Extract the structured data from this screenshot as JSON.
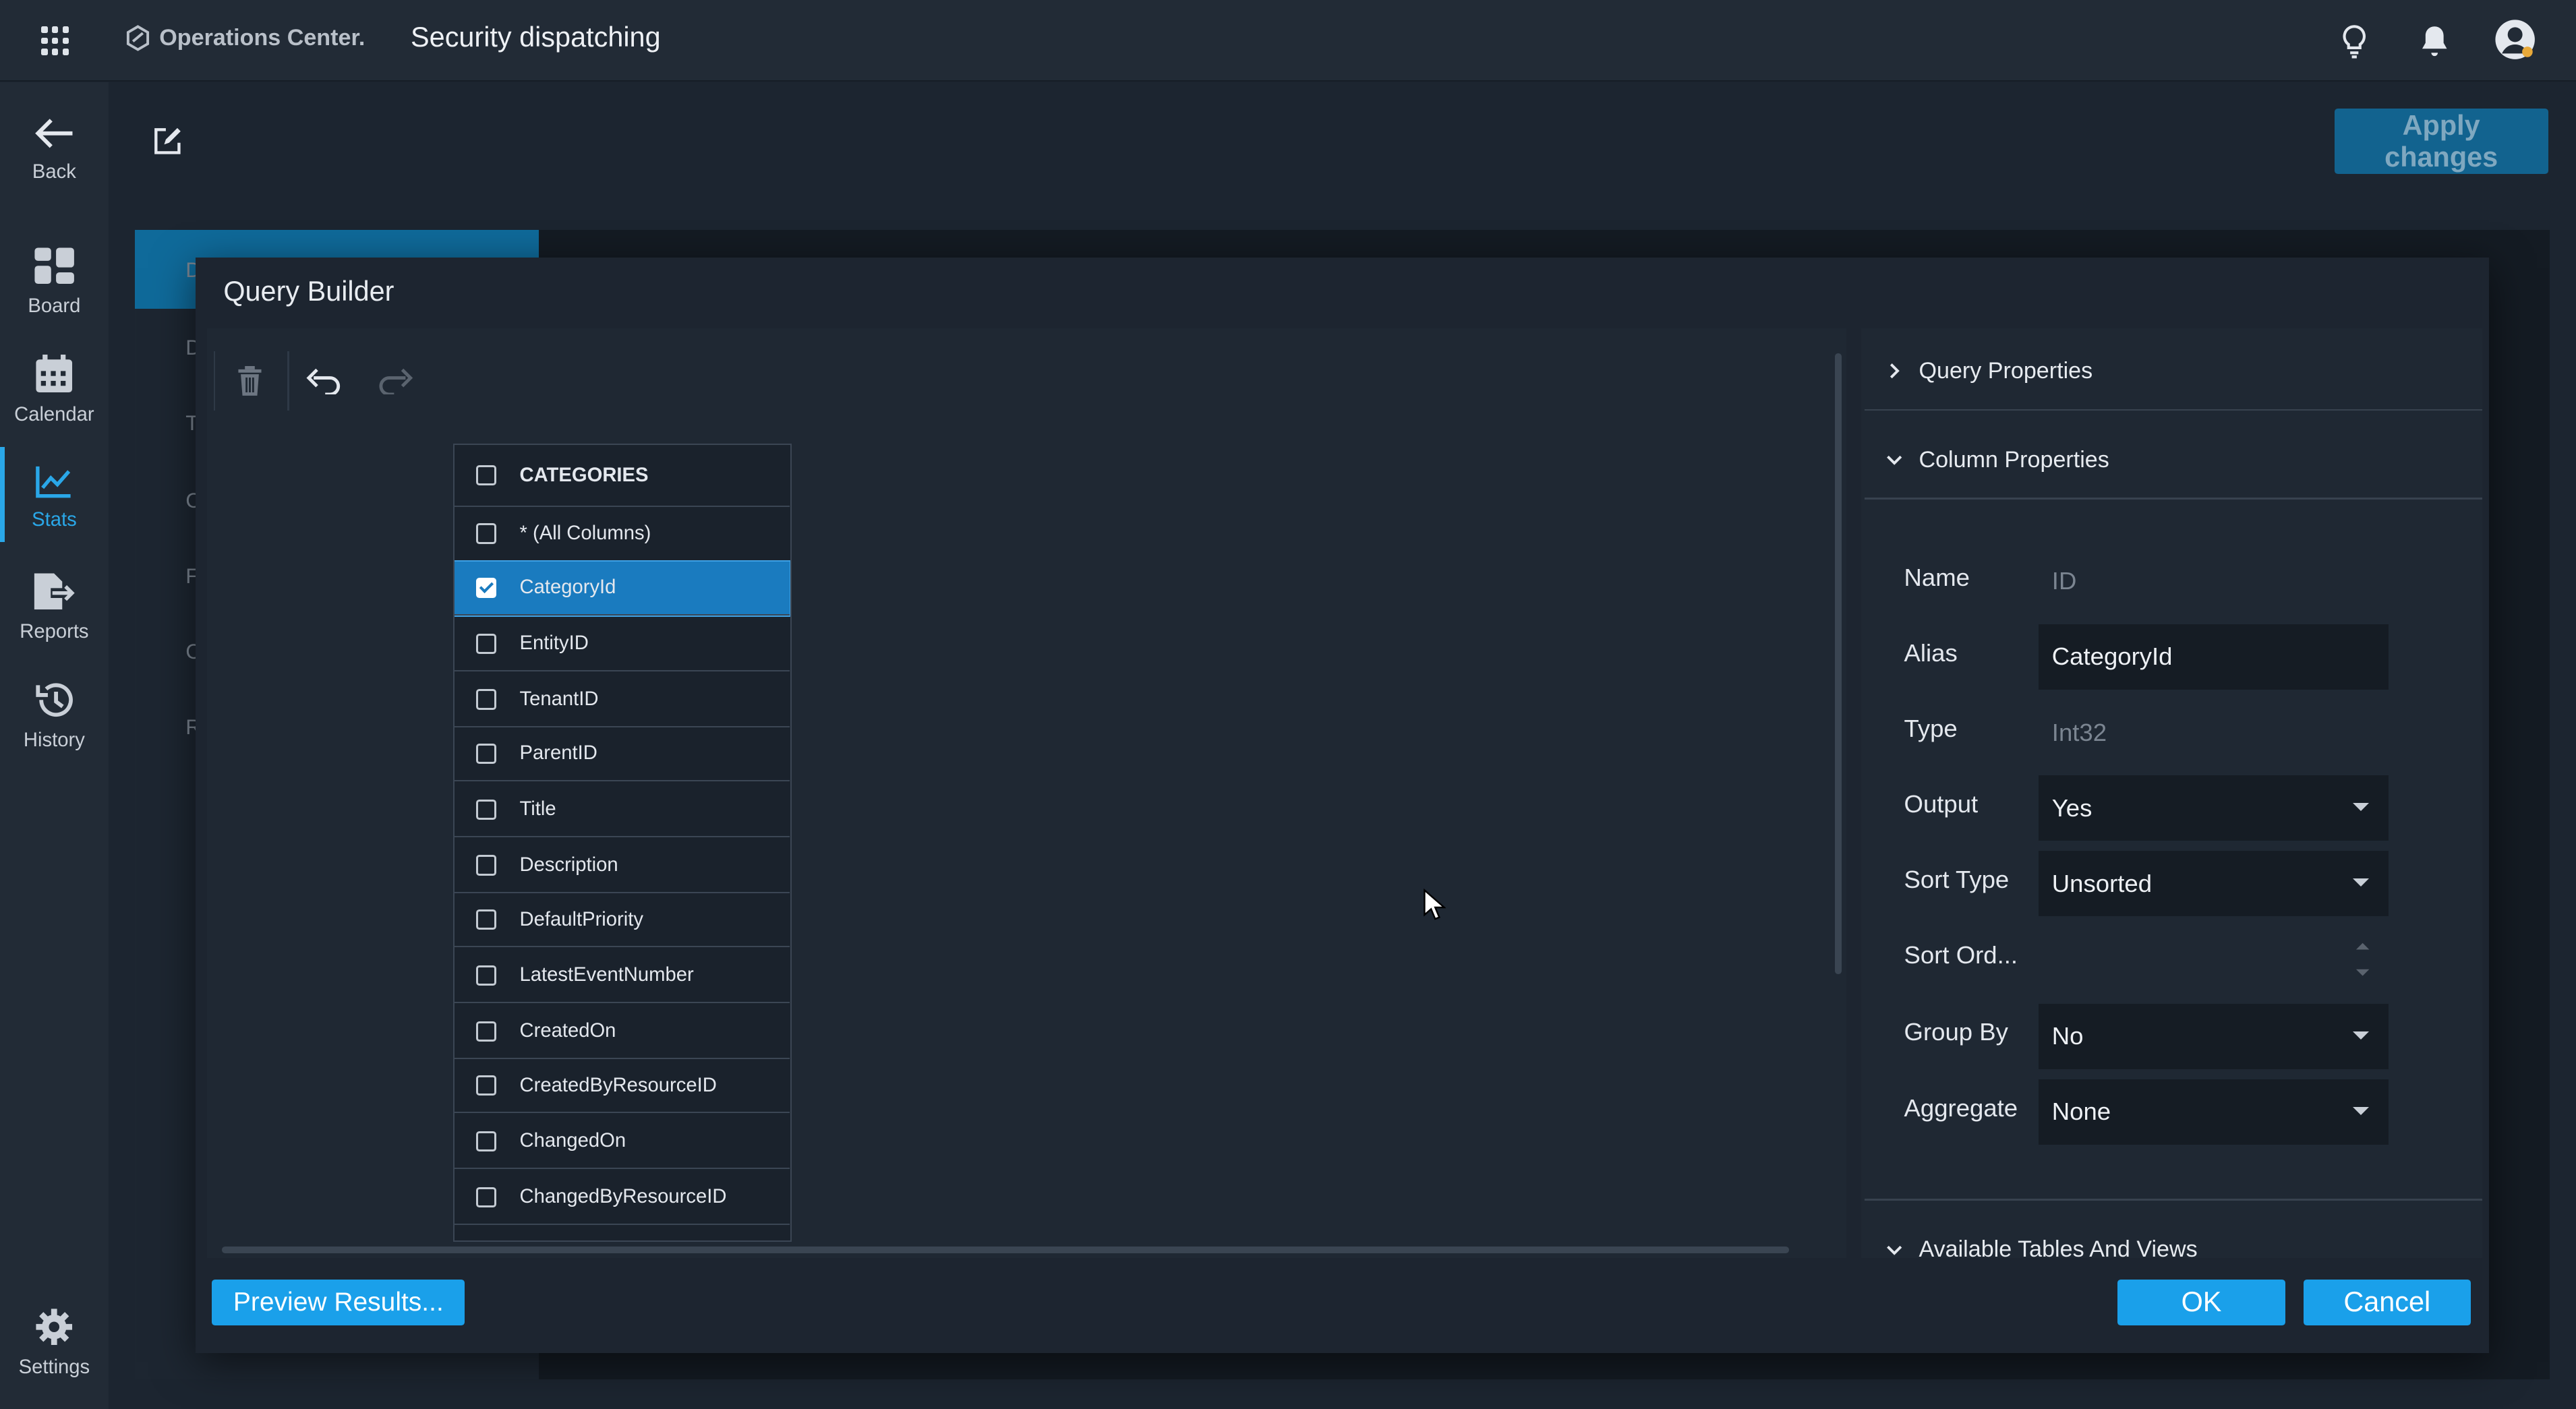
{
  "header": {
    "logo_text": "Operations Center.",
    "page_title": "Security dispatching"
  },
  "sidebar": {
    "items": [
      {
        "label": "Back",
        "icon": "back-arrow-icon"
      },
      {
        "label": "Board",
        "icon": "board-icon"
      },
      {
        "label": "Calendar",
        "icon": "calendar-icon"
      },
      {
        "label": "Stats",
        "icon": "stats-icon",
        "active": true
      },
      {
        "label": "Reports",
        "icon": "reports-icon"
      },
      {
        "label": "History",
        "icon": "history-icon"
      },
      {
        "label": "Settings",
        "icon": "gear-icon"
      }
    ]
  },
  "page": {
    "apply_label": "Apply changes",
    "bg_tab_letters": [
      "D",
      "D",
      "T",
      "C",
      "F",
      "C",
      "R"
    ]
  },
  "modal": {
    "title": "Query Builder",
    "table": {
      "name": "CATEGORIES",
      "columns": [
        {
          "label": "* (All Columns)",
          "checked": false
        },
        {
          "label": "CategoryId",
          "checked": true
        },
        {
          "label": "EntityID",
          "checked": false
        },
        {
          "label": "TenantID",
          "checked": false
        },
        {
          "label": "ParentID",
          "checked": false
        },
        {
          "label": "Title",
          "checked": false
        },
        {
          "label": "Description",
          "checked": false
        },
        {
          "label": "DefaultPriority",
          "checked": false
        },
        {
          "label": "LatestEventNumber",
          "checked": false
        },
        {
          "label": "CreatedOn",
          "checked": false
        },
        {
          "label": "CreatedByResourceID",
          "checked": false
        },
        {
          "label": "ChangedOn",
          "checked": false
        },
        {
          "label": "ChangedByResourceID",
          "checked": false
        }
      ]
    },
    "panel": {
      "query_properties": "Query Properties",
      "column_properties": "Column Properties",
      "available_tables": "Available Tables And Views",
      "props": {
        "name_label": "Name",
        "name_value": "ID",
        "alias_label": "Alias",
        "alias_value": "CategoryId",
        "type_label": "Type",
        "type_value": "Int32",
        "output_label": "Output",
        "output_value": "Yes",
        "sort_type_label": "Sort Type",
        "sort_type_value": "Unsorted",
        "sort_order_label": "Sort Ord...",
        "sort_order_value": "",
        "group_by_label": "Group By",
        "group_by_value": "No",
        "aggregate_label": "Aggregate",
        "aggregate_value": "None"
      }
    },
    "footer": {
      "preview_label": "Preview Results...",
      "ok_label": "OK",
      "cancel_label": "Cancel"
    }
  },
  "colors": {
    "accent": "#1aa0ea",
    "selected_row": "#1a7bbf",
    "topbar": "#222b36",
    "modal_bg": "#1d2530"
  }
}
